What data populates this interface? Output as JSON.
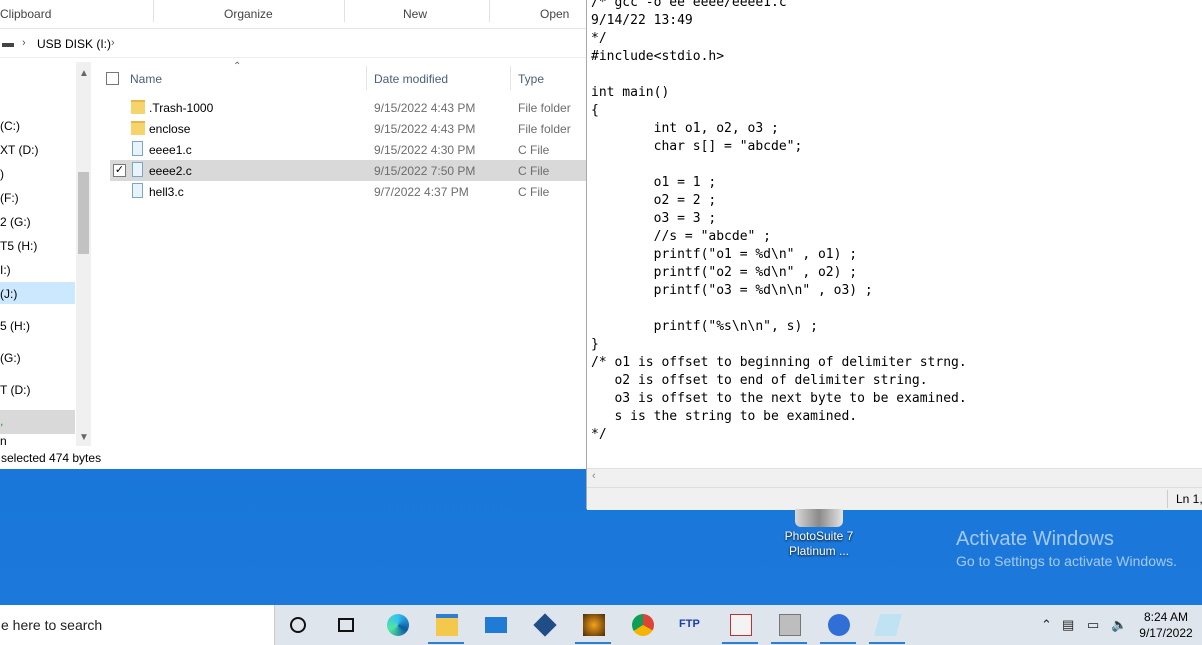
{
  "explorer": {
    "ribbon_groups": [
      "Clipboard",
      "Organize",
      "New",
      "Open"
    ],
    "address": {
      "location": "USB DISK (I:)"
    },
    "nav_items": [
      "(C:)",
      "XT (D:)",
      ")",
      "(F:)",
      "2 (G:)",
      "T5 (H:)",
      "I:)",
      "(J:)",
      "5 (H:)",
      "(G:)",
      "T (D:)",
      ",",
      "n"
    ],
    "columns": {
      "name": "Name",
      "date_modified": "Date modified",
      "type": "Type"
    },
    "files": [
      {
        "name": ".Trash-1000",
        "date": "9/15/2022 4:43 PM",
        "type": "File folder",
        "icon": "folder-icon",
        "checked": false
      },
      {
        "name": "enclose",
        "date": "9/15/2022 4:43 PM",
        "type": "File folder",
        "icon": "folder-icon",
        "checked": false
      },
      {
        "name": "eeee1.c",
        "date": "9/15/2022 4:30 PM",
        "type": "C File",
        "icon": "file-icon",
        "checked": false
      },
      {
        "name": "eeee2.c",
        "date": "9/15/2022 7:50 PM",
        "type": "C File",
        "icon": "file-icon",
        "checked": true
      },
      {
        "name": "hell3.c",
        "date": "9/7/2022 4:37 PM",
        "type": "C File",
        "icon": "file-icon",
        "checked": false
      }
    ],
    "status": "selected  474 bytes"
  },
  "notepad": {
    "code": "/* gcc -o ee eeee/eeee1.c\n9/14/22 13:49\n*/\n#include<stdio.h>\n\nint main()\n{\n        int o1, o2, o3 ;\n        char s[] = \"abcde\";\n\n        o1 = 1 ;\n        o2 = 2 ;\n        o3 = 3 ;\n        //s = \"abcde\" ;\n        printf(\"o1 = %d\\n\" , o1) ;\n        printf(\"o2 = %d\\n\" , o2) ;\n        printf(\"o3 = %d\\n\\n\" , o3) ;\n\n        printf(\"%s\\n\\n\", s) ;\n}\n/* o1 is offset to beginning of delimiter strng.\n   o2 is offset to end of delimiter string.\n   o3 is offset to the next byte to be examined.\n   s is the string to be examined.\n*/",
    "status_position": "Ln 1,"
  },
  "desktop": {
    "icon_label_1": "PhotoSuite 7",
    "icon_label_2": "Platinum ...",
    "activate_title": "Activate Windows",
    "activate_sub": "Go to Settings to activate Windows."
  },
  "taskbar": {
    "search_placeholder": "e here to search",
    "time": "8:24 AM",
    "date": "9/17/2022",
    "apps": [
      "cortana-icon",
      "task-view-icon",
      "edge-icon",
      "file-explorer-icon",
      "mail-icon",
      "virtualbox-icon",
      "media-icon",
      "chrome-icon",
      "ftp-icon",
      "app-icon",
      "archive-icon",
      "chat-icon",
      "notepad-icon"
    ]
  }
}
